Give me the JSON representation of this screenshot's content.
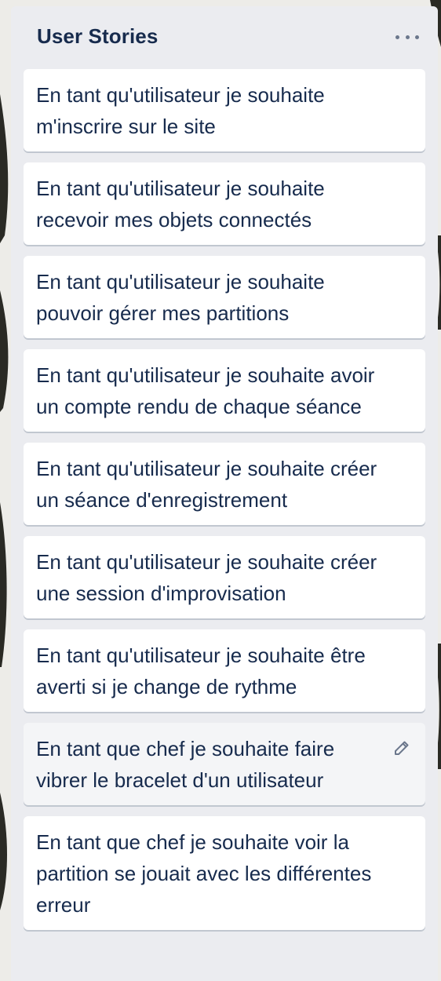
{
  "list": {
    "title": "User Stories",
    "menu_icon": "more-horizontal-icon"
  },
  "cards": [
    {
      "text": "En tant qu'utilisateur je souhaite m'inscrire sur le site"
    },
    {
      "text": "En tant qu'utilisateur je souhaite recevoir mes objets connectés"
    },
    {
      "text": "En tant qu'utilisateur je souhaite pouvoir gérer mes partitions"
    },
    {
      "text": "En tant qu'utilisateur je souhaite avoir un compte rendu de chaque séance"
    },
    {
      "text": "En tant qu'utilisateur je souhaite créer un séance d'enregistrement"
    },
    {
      "text": "En tant qu'utilisateur je souhaite créer une session d'improvisation"
    },
    {
      "text": "En tant qu'utilisateur je souhaite être averti si je change de rythme"
    },
    {
      "text": "En tant que chef je souhaite faire vibrer le bracelet d'un utilisateur",
      "hovered": true,
      "edit_icon": "pencil-icon"
    },
    {
      "text": "En tant que chef je souhaite voir la partition se jouait avec les différentes erreur"
    }
  ],
  "colors": {
    "list_background": "#ebecf0",
    "card_background": "#ffffff",
    "card_hover_background": "#f4f5f7",
    "text": "#172b4d",
    "icon": "#6b778c"
  }
}
